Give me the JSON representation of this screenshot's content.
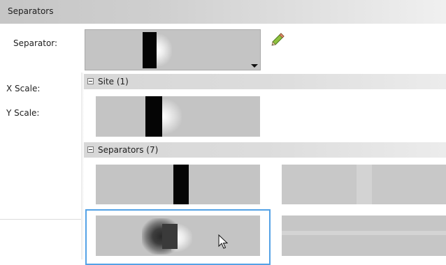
{
  "header": {
    "title": "Separators"
  },
  "properties": {
    "separator_label": "Separator:",
    "x_scale_label": "X Scale:",
    "y_scale_label": "Y Scale:"
  },
  "dropdown": {
    "groups": [
      {
        "label": "Site (1)",
        "icon": "collapse-icon"
      },
      {
        "label": "Separators (7)",
        "icon": "collapse-icon"
      }
    ]
  },
  "colors": {
    "focus_border": "#54a2e6",
    "thumb_bg": "#c4c4c4"
  }
}
